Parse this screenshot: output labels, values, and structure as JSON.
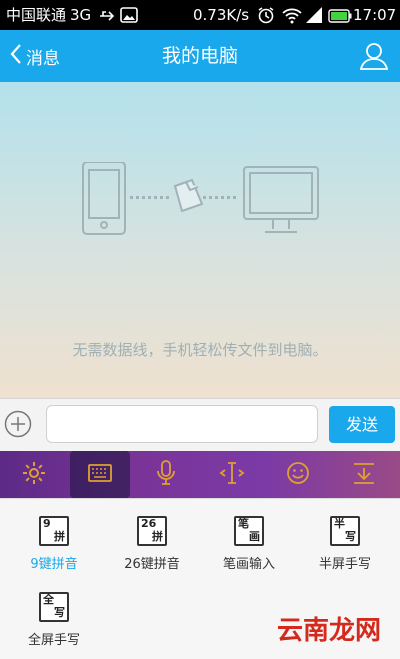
{
  "status_bar": {
    "carrier": "中国联通",
    "network": "3G",
    "speed": "0.73K/s",
    "time": "17:07",
    "icons": [
      "usb-icon",
      "image-icon",
      "alarm-icon",
      "wifi-icon",
      "signal-icon",
      "battery-icon"
    ]
  },
  "header": {
    "back_label": "消息",
    "title": "我的电脑",
    "accent_color": "#19a8ec"
  },
  "chat": {
    "hint": "无需数据线，手机轻松传文件到电脑。"
  },
  "input_bar": {
    "placeholder": "",
    "send_label": "发送"
  },
  "keyboard_toolbar": {
    "buttons": [
      "settings-icon",
      "keyboard-icon",
      "microphone-icon",
      "cursor-icon",
      "emoji-icon",
      "hide-keyboard-icon"
    ],
    "active": "keyboard-icon"
  },
  "input_methods": [
    {
      "key_top": "9",
      "key_bottom": "拼",
      "label": "9键拼音",
      "active": true
    },
    {
      "key_top": "26",
      "key_bottom": "拼",
      "label": "26键拼音",
      "active": false
    },
    {
      "key_top": "笔",
      "key_bottom": "画",
      "label": "笔画输入",
      "active": false
    },
    {
      "key_top": "半",
      "key_bottom": "写",
      "label": "半屏手写",
      "active": false
    },
    {
      "key_top": "全",
      "key_bottom": "写",
      "label": "全屏手写",
      "active": false
    }
  ],
  "watermark": {
    "text": "云南龙网"
  }
}
